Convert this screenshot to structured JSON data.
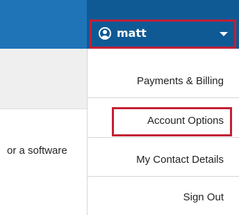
{
  "header": {
    "user": {
      "name": "matt",
      "icon": "user-circle-icon",
      "dropdown_icon": "caret-down-icon"
    }
  },
  "page": {
    "partial_text": "or a software"
  },
  "dropdown": {
    "items": [
      {
        "label": "Payments & Billing"
      },
      {
        "label": "Account Options",
        "highlighted": true
      },
      {
        "label": "My Contact Details"
      },
      {
        "label": "Sign Out"
      }
    ]
  },
  "colors": {
    "header_blue": "#1f74b8",
    "user_button_blue": "#0f5a95",
    "highlight_red": "#c31f33"
  }
}
